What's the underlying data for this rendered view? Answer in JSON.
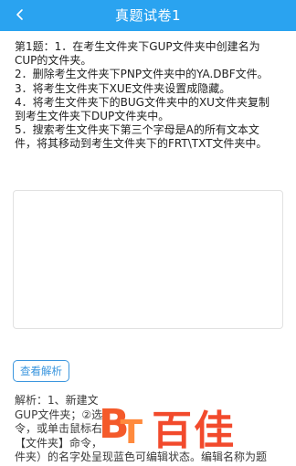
{
  "header": {
    "title": "真题试卷1",
    "back_icon": "chevron-left-icon",
    "background": "#2aa3f0"
  },
  "question": {
    "lines": [
      "第1题：1．在考生文件夹下GUP文件夹中创建名为",
      "CUP的文件夹。",
      "2．删除考生文件夹下PNP文件夹中的YA.DBF文件。",
      "3．将考生文件夹下XUE文件夹设置成隐藏。",
      "4．将考生文件夹下的BUG文件夹中的XU文件夹复制",
      "到考生文件夹下DUP文件夹中。",
      "5．搜索考生文件夹下第三个字母是A的所有文本文",
      "件，将其移动到考生文件夹下的FRT\\TXT文件夹中。"
    ]
  },
  "answer": {
    "value": ""
  },
  "analysis_button": {
    "label": "查看解析",
    "color": "#3b96de"
  },
  "analysis": {
    "lines": [
      "解析：1、新建文",
      "GUP文件夹；②选",
      "令，或单击鼠标右",
      "【文件夹】命令，",
      "件夹）的名字处呈现蓝色可编辑状态。编辑名称为题"
    ]
  },
  "watermark": {
    "logo_letters": "BT",
    "text": "百佳"
  }
}
